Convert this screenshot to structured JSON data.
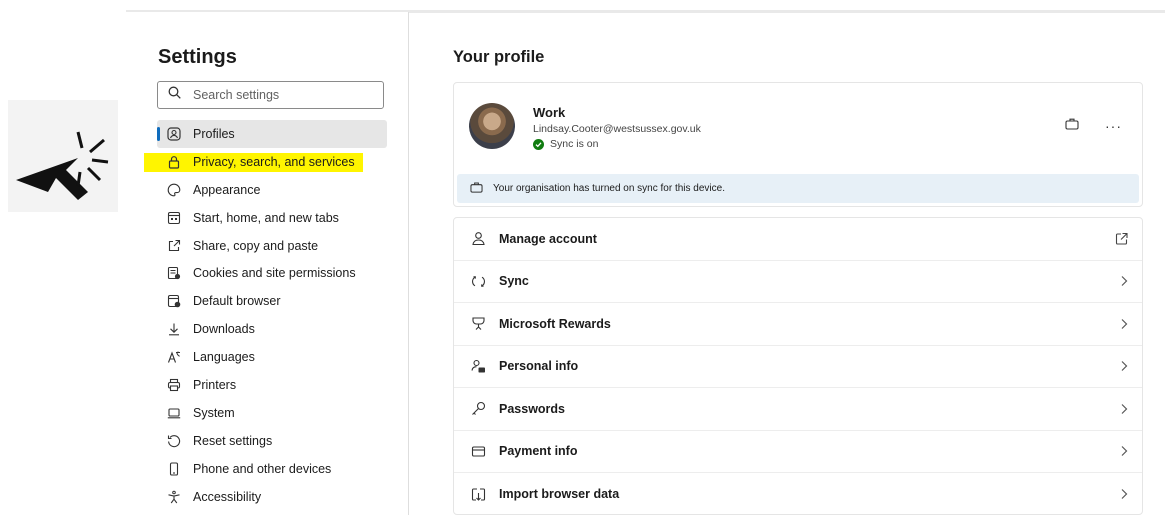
{
  "settings": {
    "title": "Settings",
    "search_placeholder": "Search settings",
    "nav": [
      {
        "label": "Profiles",
        "icon": "profile-icon"
      },
      {
        "label": "Privacy, search, and services",
        "icon": "lock-icon"
      },
      {
        "label": "Appearance",
        "icon": "appearance-icon"
      },
      {
        "label": "Start, home, and new tabs",
        "icon": "start-icon"
      },
      {
        "label": "Share, copy and paste",
        "icon": "share-icon"
      },
      {
        "label": "Cookies and site permissions",
        "icon": "cookies-icon"
      },
      {
        "label": "Default browser",
        "icon": "browser-icon"
      },
      {
        "label": "Downloads",
        "icon": "download-icon"
      },
      {
        "label": "Languages",
        "icon": "languages-icon"
      },
      {
        "label": "Printers",
        "icon": "printer-icon"
      },
      {
        "label": "System",
        "icon": "system-icon"
      },
      {
        "label": "Reset settings",
        "icon": "reset-icon"
      },
      {
        "label": "Phone and other devices",
        "icon": "phone-icon"
      },
      {
        "label": "Accessibility",
        "icon": "accessibility-icon"
      }
    ]
  },
  "profile": {
    "heading": "Your profile",
    "name": "Work",
    "email": "Lindsay.Cooter@westsussex.gov.uk",
    "sync_status": "Sync is on",
    "org_notice": "Your organisation has turned on sync for this device."
  },
  "options": [
    {
      "label": "Manage account",
      "icon": "account-icon",
      "trail": "external-link-icon"
    },
    {
      "label": "Sync",
      "icon": "sync-icon",
      "trail": "chevron-right-icon"
    },
    {
      "label": "Microsoft Rewards",
      "icon": "rewards-icon",
      "trail": "chevron-right-icon"
    },
    {
      "label": "Personal info",
      "icon": "personal-info-icon",
      "trail": "chevron-right-icon"
    },
    {
      "label": "Passwords",
      "icon": "key-icon",
      "trail": "chevron-right-icon"
    },
    {
      "label": "Payment info",
      "icon": "card-icon",
      "trail": "chevron-right-icon"
    },
    {
      "label": "Import browser data",
      "icon": "import-icon",
      "trail": "chevron-right-icon"
    }
  ],
  "colors": {
    "accent": "#0f6cbd",
    "highlight": "#fff500",
    "sync_green": "#107c10",
    "info_bar": "#e7f0f7"
  }
}
